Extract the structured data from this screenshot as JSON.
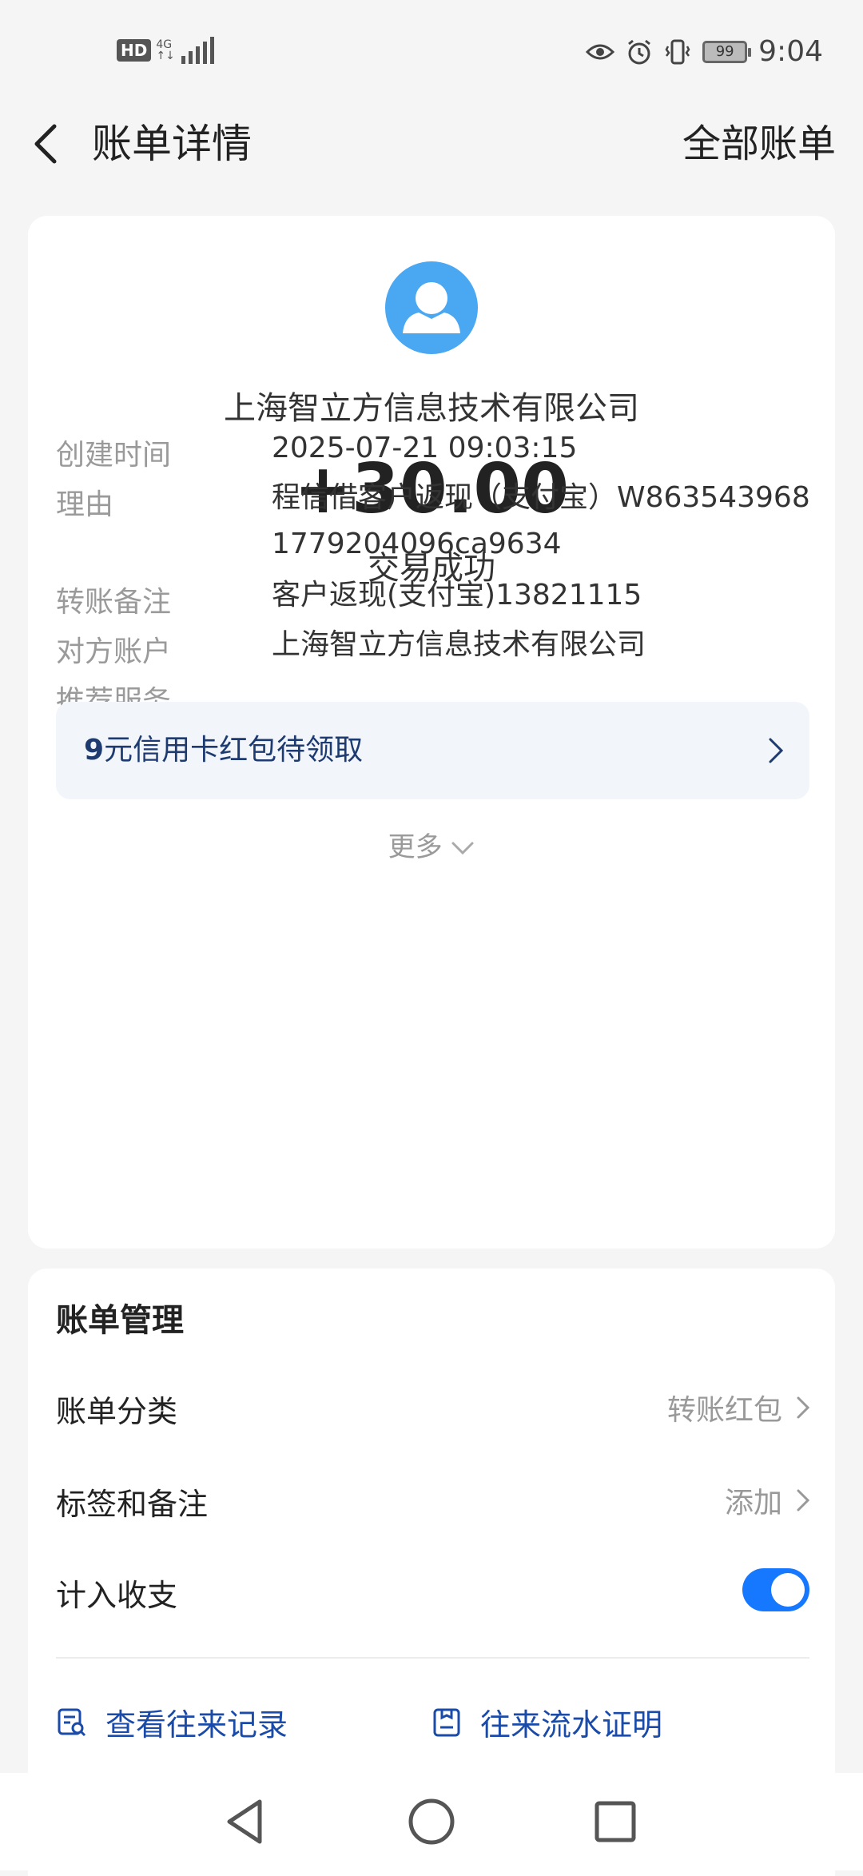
{
  "status_bar": {
    "hd": "HD",
    "network": "4G",
    "battery": "99",
    "time": "9:04",
    "icons": [
      "hd-icon",
      "signal-icon",
      "eye-icon",
      "alarm-icon",
      "vibrate-icon",
      "battery-icon"
    ]
  },
  "header": {
    "title": "账单详情",
    "right_link": "全部账单"
  },
  "transaction": {
    "merchant": "上海智立方信息技术有限公司",
    "amount": "+30.00",
    "status": "交易成功",
    "details": [
      {
        "label": "创建时间",
        "value": "2025-07-21 09:03:15"
      },
      {
        "label": "理由",
        "value": "程信借客户返现（支付宝）W8635439681779204096ca9634"
      },
      {
        "label": "转账备注",
        "value": "客户返现(支付宝)13821115"
      },
      {
        "label": "对方账户",
        "value": "上海智立方信息技术有限公司"
      },
      {
        "label": "推荐服务",
        "value": ""
      }
    ],
    "promo": {
      "prefix": "9",
      "text": "元信用卡红包待领取"
    },
    "more": "更多"
  },
  "manage": {
    "title": "账单管理",
    "category_label": "账单分类",
    "category_value": "转账红包",
    "tags_label": "标签和备注",
    "tags_value": "添加",
    "include_label": "计入收支",
    "include_enabled": true,
    "links": [
      "查看往来记录",
      "往来流水证明"
    ]
  },
  "colors": {
    "accent": "#1677ff",
    "link": "#1a4ba8",
    "avatar": "#4aa8f3",
    "promo_text": "#1d3b70"
  }
}
